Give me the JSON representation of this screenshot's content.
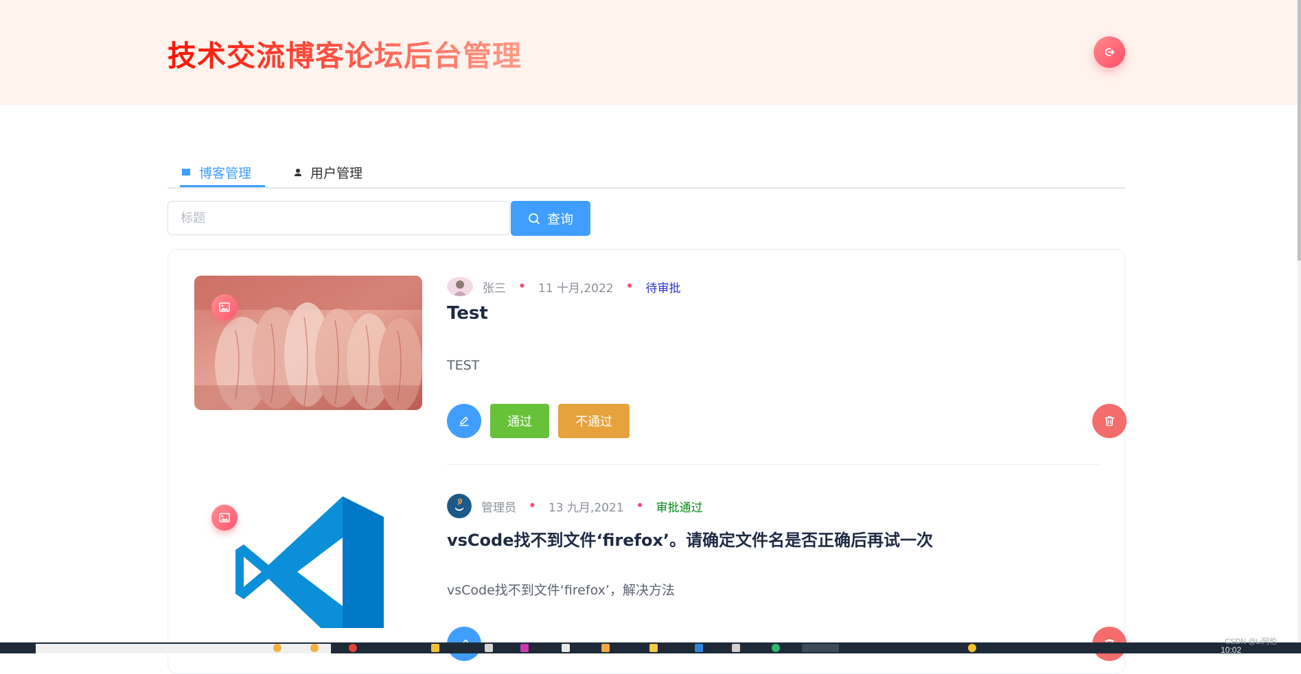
{
  "header": {
    "title": "技术交流博客论坛后台管理",
    "logout_icon": "logout-icon"
  },
  "tabs": [
    {
      "label": "博客管理",
      "icon": "book-icon",
      "active": true
    },
    {
      "label": "用户管理",
      "icon": "user-icon",
      "active": false
    }
  ],
  "search": {
    "placeholder": "标题",
    "value": "",
    "button_label": "查询",
    "button_icon": "search-icon"
  },
  "posts": [
    {
      "author": "张三",
      "date": "11 十月,2022",
      "status": "待审批",
      "title": "Test",
      "summary": "TEST",
      "approve_label": "通过",
      "reject_label": "不通过",
      "thumbnail": "banknotes-photo"
    },
    {
      "author": "管理员",
      "date": "13 九月,2021",
      "status": "审批通过",
      "title": "vsCode找不到文件‘firefox’。请确定文件名是否正确后再试一次",
      "summary": "vsCode找不到文件‘firefox’，解决方法",
      "thumbnail": "vscode-logo"
    }
  ],
  "taskbar": {
    "watermark": "CSDN @Li阿伦",
    "time": "10:02"
  },
  "colors": {
    "primary": "#409eff",
    "success": "#67c23a",
    "warning": "#e6a23c",
    "danger": "#f56c6c",
    "header_bg": "#fff3ee"
  }
}
